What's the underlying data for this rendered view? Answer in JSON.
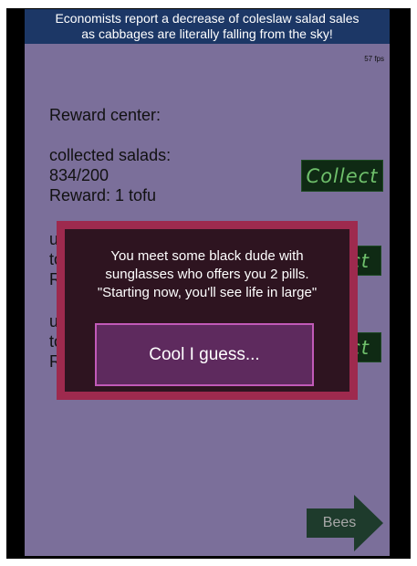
{
  "news": {
    "lines": [
      "Economists report a decrease of coleslaw salad sales",
      "as cabbages are literally falling from the sky!"
    ]
  },
  "fps": "57 fps",
  "reward_center": {
    "title": "Reward center:",
    "entries": [
      {
        "line1": "collected salads:",
        "line2": "834/200",
        "line3": "Reward: 1 tofu",
        "button": "Collect"
      },
      {
        "line1": "u",
        "line2": "to",
        "line3": "R",
        "button": "ct"
      },
      {
        "line1": "u",
        "line2": "to",
        "line3": "R",
        "button": "ct"
      }
    ]
  },
  "dialog": {
    "message_lines": [
      "You meet some black dude with",
      "sunglasses who offers you 2 pills.",
      "\"Starting now, you'll see life in large\""
    ],
    "button_label": "Cool I guess..."
  },
  "nav": {
    "bees_label": "Bees"
  },
  "colors": {
    "background": "#7b6f9a",
    "banner": "#1c3766",
    "collect_bg": "#0f2a14",
    "collect_text": "#6fc06b",
    "dialog_border": "#9e2a4e",
    "dialog_bg": "#2e1420",
    "dialog_button": "#5e2a5e"
  }
}
